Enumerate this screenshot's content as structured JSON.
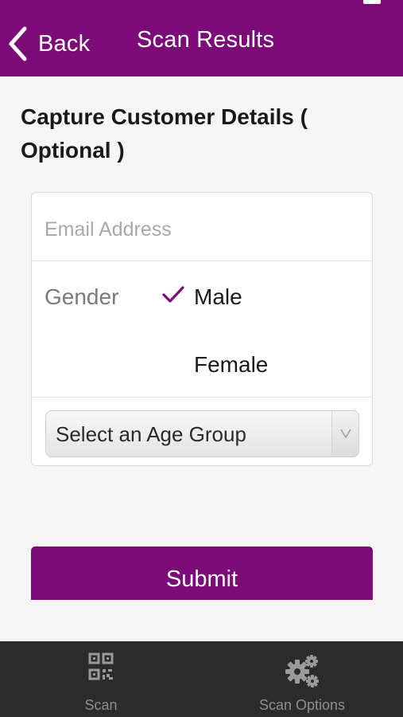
{
  "header": {
    "back_label": "Back",
    "title": "Scan Results",
    "background": "#7b0c77"
  },
  "form": {
    "section_title": "Capture Customer Details ( Optional )",
    "email": {
      "placeholder": "Email Address",
      "value": ""
    },
    "gender": {
      "label": "Gender",
      "options": [
        {
          "label": "Male",
          "selected": true
        },
        {
          "label": "Female",
          "selected": false
        }
      ]
    },
    "age_group": {
      "selected_label": "Select an Age Group"
    },
    "submit_label": "Submit"
  },
  "tabbar": {
    "items": [
      {
        "label": "Scan",
        "icon": "qr-code-icon"
      },
      {
        "label": "Scan Options",
        "icon": "gears-icon"
      }
    ]
  },
  "colors": {
    "accent": "#7b0c77",
    "tabbar_bg": "#2b2b2b",
    "page_bg": "#f6f6f6"
  }
}
